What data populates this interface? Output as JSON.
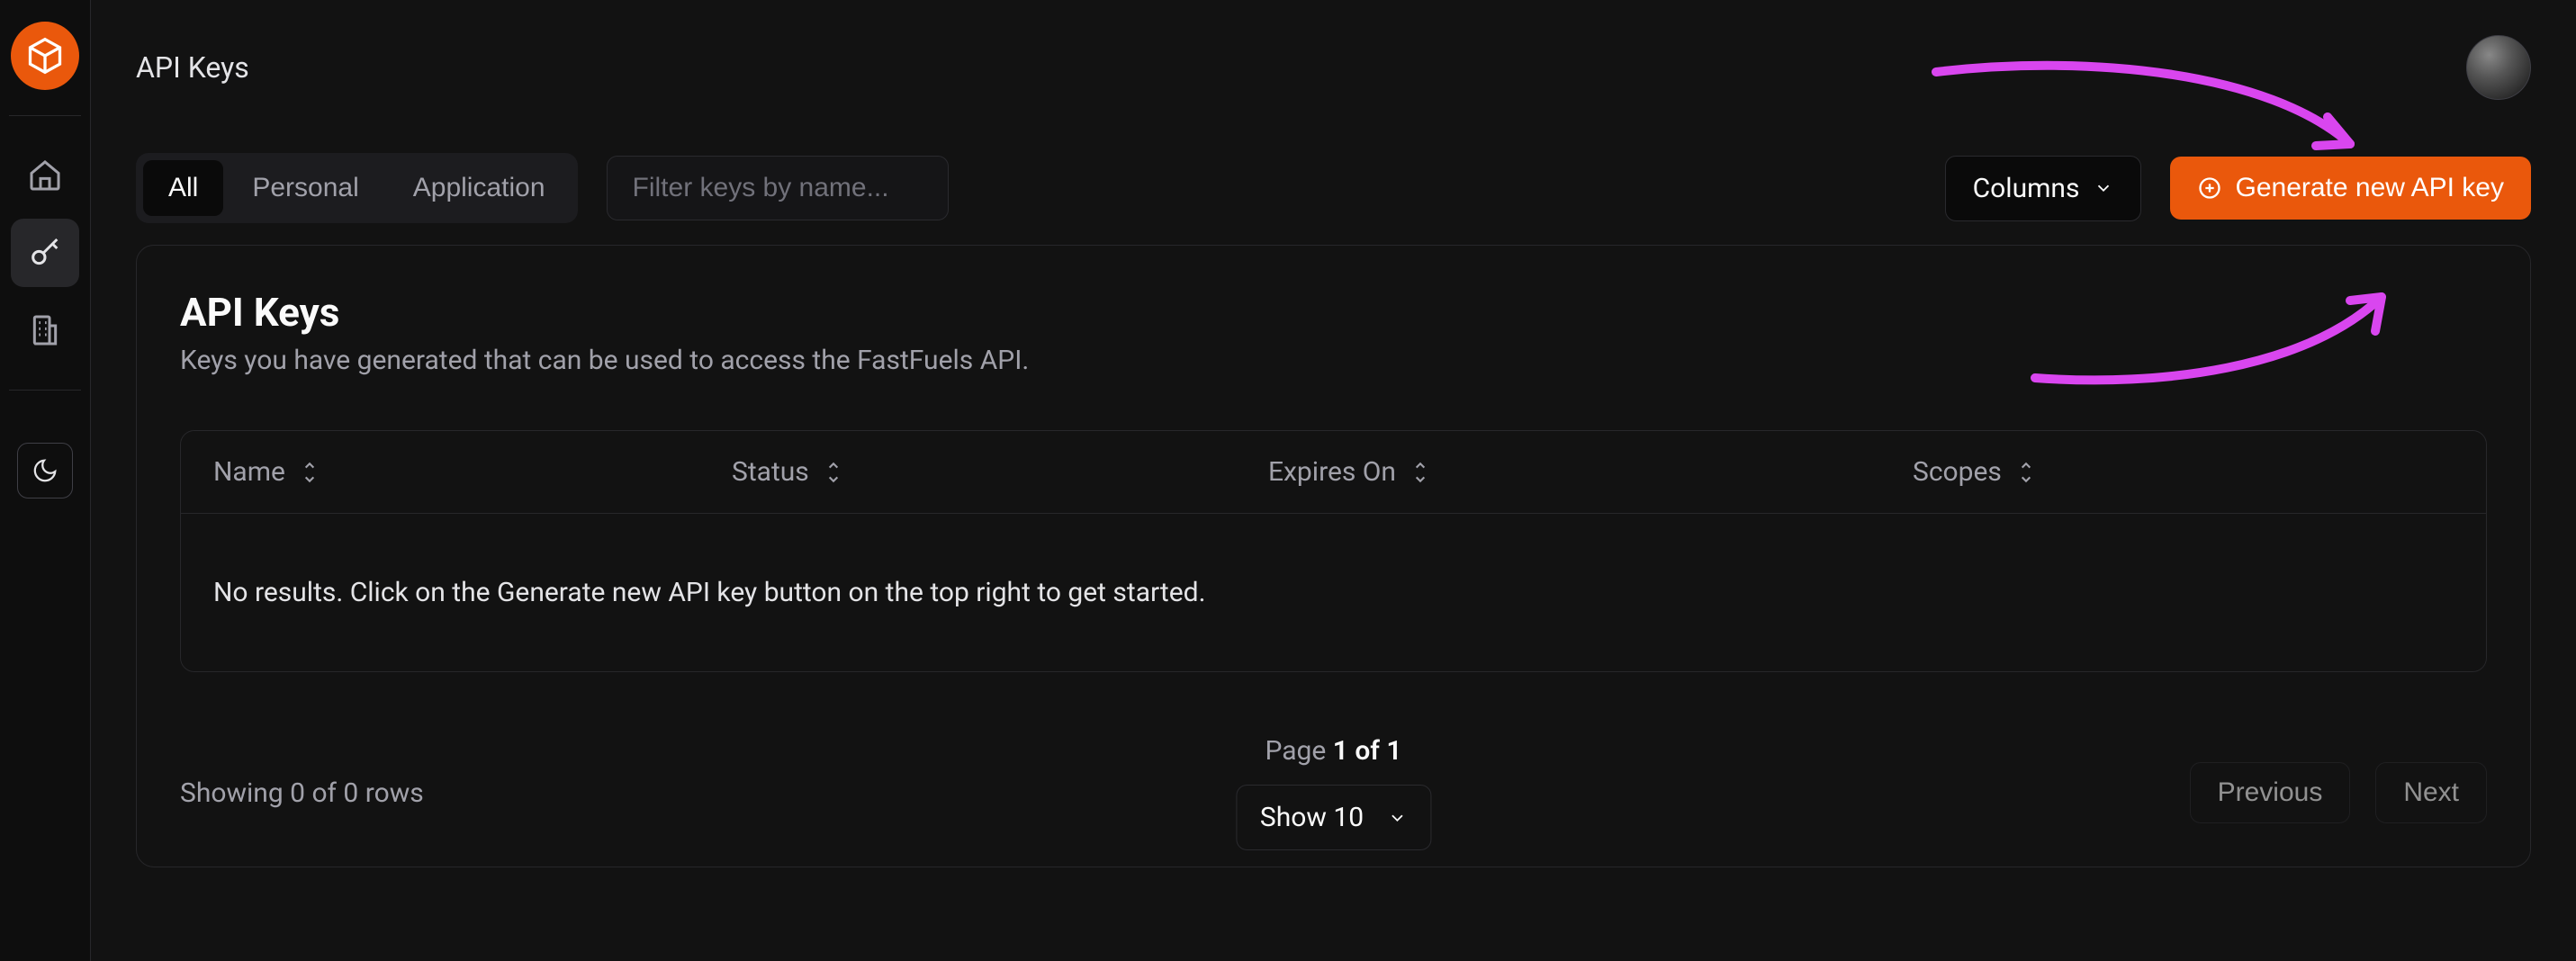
{
  "page": {
    "title": "API Keys"
  },
  "filterTabs": {
    "all": "All",
    "personal": "Personal",
    "application": "Application"
  },
  "filter": {
    "placeholder": "Filter keys by name..."
  },
  "toolbar": {
    "columns_label": "Columns",
    "generate_label": "Generate new API key"
  },
  "card": {
    "title": "API Keys",
    "subtitle": "Keys you have generated that can be used to access the FastFuels API."
  },
  "table": {
    "columns": {
      "name": "Name",
      "status": "Status",
      "expires": "Expires On",
      "scopes": "Scopes"
    },
    "empty_message": "No results. Click on the Generate new API key button on the top right to get started."
  },
  "footer": {
    "showing_prefix": "Showing ",
    "showing_counts": "0 of 0",
    "showing_suffix": " rows",
    "page_prefix": "Page ",
    "page_value": "1 of 1",
    "show_label": "Show 10",
    "previous": "Previous",
    "next": "Next"
  },
  "colors": {
    "accent": "#ea580c",
    "annotation": "#d946ef"
  }
}
